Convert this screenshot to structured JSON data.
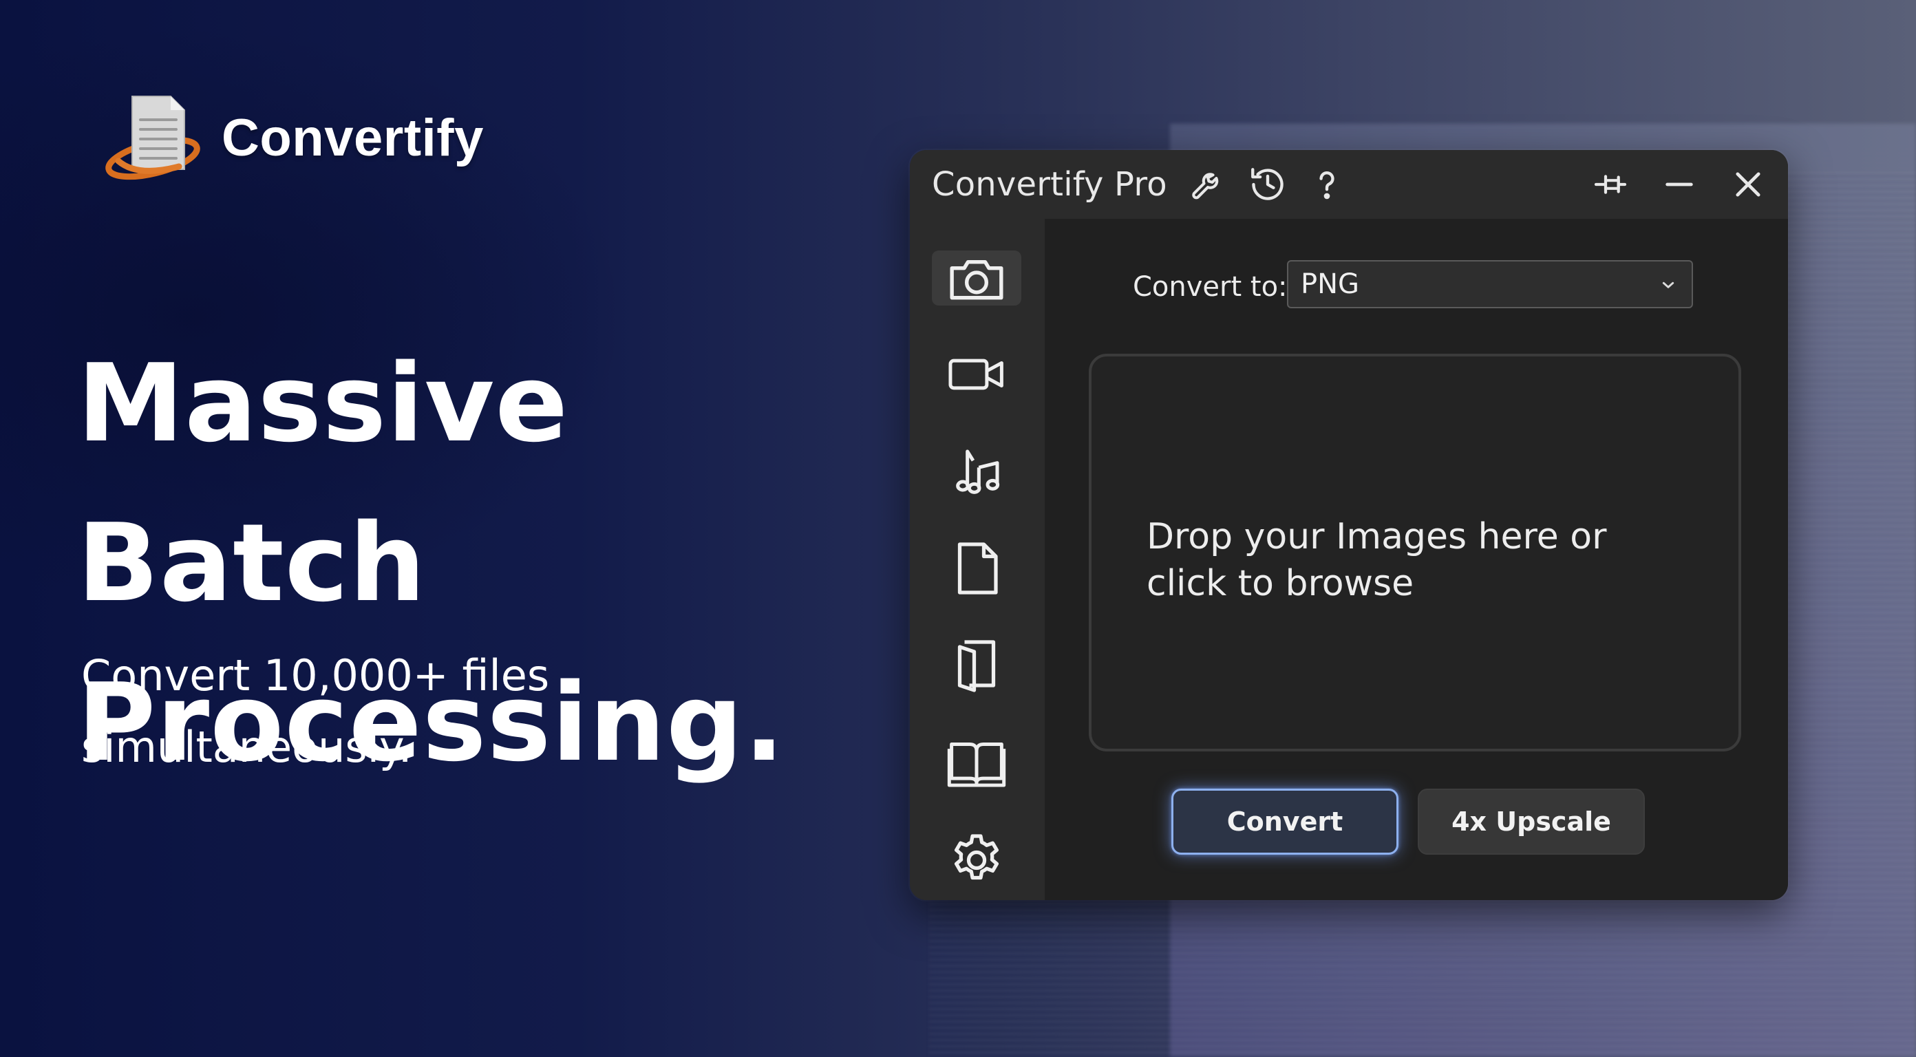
{
  "brand": {
    "name": "Convertify",
    "logo_icon": "document-orbit-icon"
  },
  "hero": {
    "title": "Massive Batch Processing.",
    "subtitle": "Convert 10,000+ files simultaneously."
  },
  "window": {
    "title": "Convertify Pro",
    "toolbar_icons": [
      "wrench-icon",
      "history-icon",
      "help-icon"
    ],
    "controls": [
      "pin-icon",
      "minimize-icon",
      "close-icon"
    ]
  },
  "sidebar": {
    "items": [
      {
        "icon": "camera-icon",
        "active": true
      },
      {
        "icon": "video-camera-icon",
        "active": false
      },
      {
        "icon": "music-note-icon",
        "active": false
      },
      {
        "icon": "document-icon",
        "active": false
      },
      {
        "icon": "folded-page-icon",
        "active": false
      },
      {
        "icon": "book-icon",
        "active": false
      },
      {
        "icon": "gear-icon",
        "active": false
      }
    ]
  },
  "convert": {
    "label": "Convert to:",
    "selected": "PNG"
  },
  "dropzone": {
    "text": "Drop your Images here or click to browse"
  },
  "buttons": {
    "convert": "Convert",
    "upscale": "4x Upscale"
  },
  "colors": {
    "accent": "#8db0ee",
    "window_bg": "#2a2a2a",
    "content_bg": "#202020",
    "logo_orange": "#e07a2a"
  }
}
